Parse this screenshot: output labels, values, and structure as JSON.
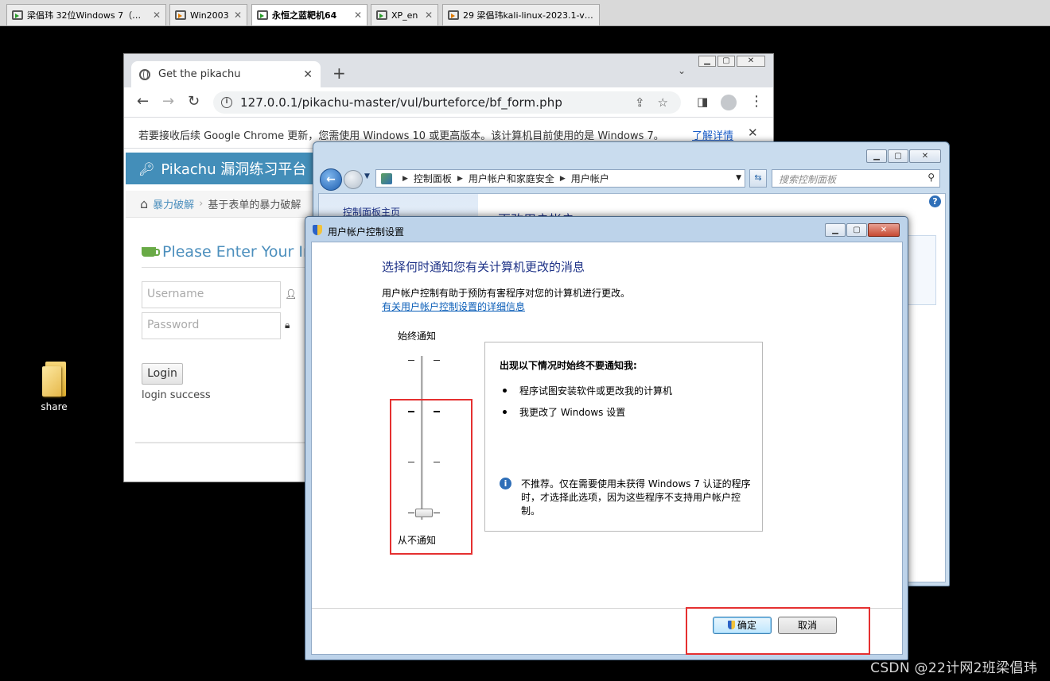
{
  "vm_tabs": [
    {
      "label": "梁倡玮 32位Windows 7（密…",
      "icon": "vm-running-icon",
      "active": false
    },
    {
      "label": "Win2003",
      "icon": "vm-suspended-icon",
      "active": false
    },
    {
      "label": "永恒之蓝靶机64",
      "icon": "vm-running-icon",
      "active": true
    },
    {
      "label": "XP_en",
      "icon": "vm-running-icon",
      "active": false
    },
    {
      "label": "29  梁倡玮kali-linux-2023.1-v…",
      "icon": "vm-suspended-icon",
      "active": false
    }
  ],
  "desktop": {
    "share_label": "share"
  },
  "chrome": {
    "tab_title": "Get the pikachu",
    "url": "127.0.0.1/pikachu-master/vul/burteforce/bf_form.php",
    "infobar_text": "若要接收后续 Google Chrome 更新，您需使用 Windows 10 或更高版本。该计算机目前使用的是 Windows 7。",
    "infobar_link": "了解详情"
  },
  "pikachu": {
    "brand": "Pikachu 漏洞练习平台",
    "breadcrumb_link": "暴力破解",
    "breadcrumb_current": "基于表单的暴力破解",
    "form_title": "Please Enter Your Information",
    "username_placeholder": "Username",
    "password_placeholder": "Password",
    "login_button": "Login",
    "status": "login success"
  },
  "control_panel": {
    "breadcrumb": [
      "控制面板",
      "用户帐户和家庭安全",
      "用户帐户"
    ],
    "search_placeholder": "搜索控制面板",
    "sidebar_home": "控制面板主页",
    "heading": "更改用户帐户"
  },
  "uac": {
    "title": "用户帐户控制设置",
    "heading": "选择何时通知您有关计算机更改的消息",
    "description": "用户帐户控制有助于预防有害程序对您的计算机进行更改。",
    "more_info_link": "有关用户帐户控制设置的详细信息",
    "slider_top": "始终通知",
    "slider_bottom": "从不通知",
    "slider_level": 0,
    "slider_levels": 4,
    "info_title": "出现以下情况时始终不要通知我:",
    "bullets": [
      "程序试图安装软件或更改我的计算机",
      "我更改了 Windows 设置"
    ],
    "warning": "不推荐。仅在需要使用未获得 Windows 7 认证的程序时，才选择此选项，因为这些程序不支持用户帐户控制。",
    "ok_button": "确定",
    "cancel_button": "取消"
  },
  "watermark": "CSDN @22计网2班梁倡玮",
  "colors": {
    "highlight": "#e53030",
    "pikachu_header": "#438eb9",
    "win7_heading": "#1e3287"
  }
}
